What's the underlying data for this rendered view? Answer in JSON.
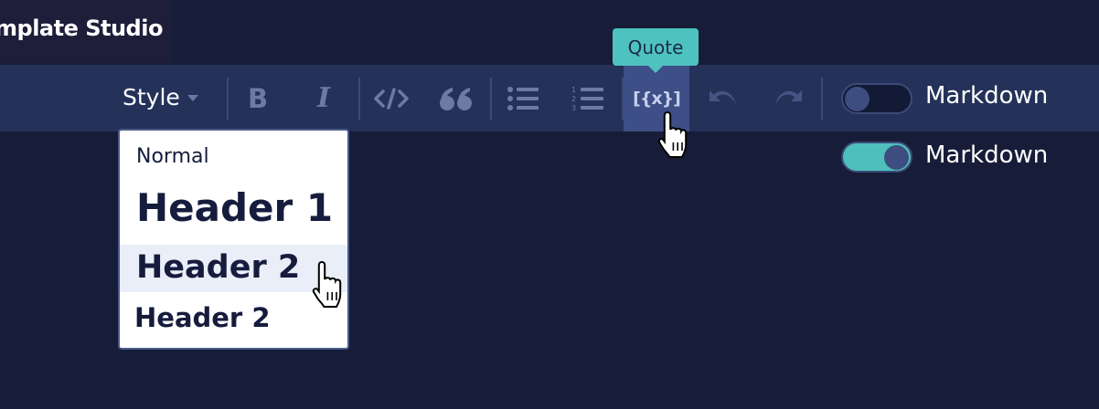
{
  "app": {
    "title": "mplate Studio"
  },
  "toolbar": {
    "style_label": "Style",
    "buttons": [
      {
        "name": "bold",
        "icon": "bold-icon",
        "glyph": "B"
      },
      {
        "name": "italic",
        "icon": "italic-icon",
        "glyph": "I"
      },
      {
        "name": "code",
        "icon": "code-icon"
      },
      {
        "name": "quote",
        "icon": "quote-icon"
      },
      {
        "name": "bulleted-list",
        "icon": "bulleted-list-icon"
      },
      {
        "name": "numbered-list",
        "icon": "numbered-list-icon"
      },
      {
        "name": "variable",
        "icon": "variable-icon",
        "glyph": "[{x}]",
        "active": true
      },
      {
        "name": "undo",
        "icon": "undo-icon",
        "disabled": true
      },
      {
        "name": "redo",
        "icon": "redo-icon",
        "disabled": true
      }
    ],
    "markdown_toggle": {
      "label": "Markdown",
      "state": "off"
    }
  },
  "tooltip": {
    "text": "Quote"
  },
  "secondary_toggle": {
    "label": "Markdown",
    "state": "on"
  },
  "style_menu": {
    "items": [
      {
        "label": "Normal"
      },
      {
        "label": "Header 1"
      },
      {
        "label": "Header 2",
        "hovered": true
      },
      {
        "label": "Header 2"
      }
    ]
  },
  "colors": {
    "background": "#171d38",
    "toolbar": "#243159",
    "accent": "#4ec2bf",
    "active_button": "#3d4f86",
    "menu_hover": "#eaeef8"
  }
}
